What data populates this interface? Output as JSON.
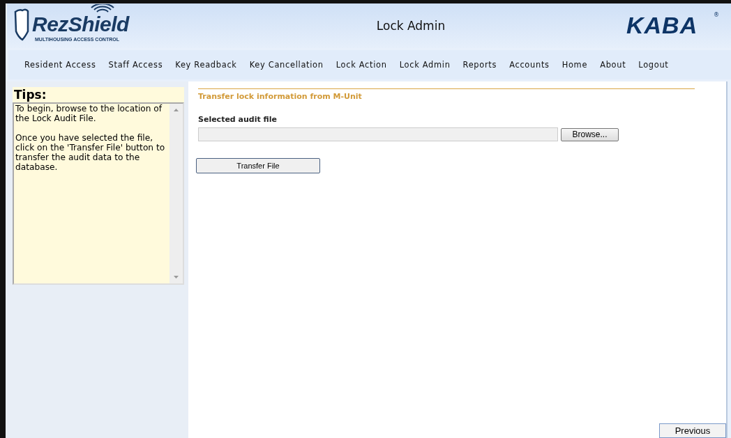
{
  "header": {
    "logo_name": "RezShield",
    "logo_tagline": "MULTIHOUSING ACCESS CONTROL",
    "page_title": "Lock Admin",
    "brand": "KABA",
    "brand_mark": "®"
  },
  "nav": [
    {
      "label": "Resident Access"
    },
    {
      "label": "Staff Access"
    },
    {
      "label": "Key Readback"
    },
    {
      "label": "Key Cancellation"
    },
    {
      "label": "Lock Action"
    },
    {
      "label": "Lock Admin"
    },
    {
      "label": "Reports"
    },
    {
      "label": "Accounts"
    },
    {
      "label": "Home"
    },
    {
      "label": "About"
    },
    {
      "label": "Logout"
    }
  ],
  "tips": {
    "title": "Tips:",
    "paragraphs": [
      "To begin, browse to the location of the Lock Audit File.",
      "Once you have selected the file, click on the 'Transfer File' button to transfer the audit data to the database."
    ]
  },
  "main": {
    "section_title": "Transfer lock information from M-Unit",
    "field_label": "Selected audit file",
    "browse_button": "Browse...",
    "transfer_button": "Transfer File"
  },
  "footer": {
    "previous_button": "Previous"
  }
}
